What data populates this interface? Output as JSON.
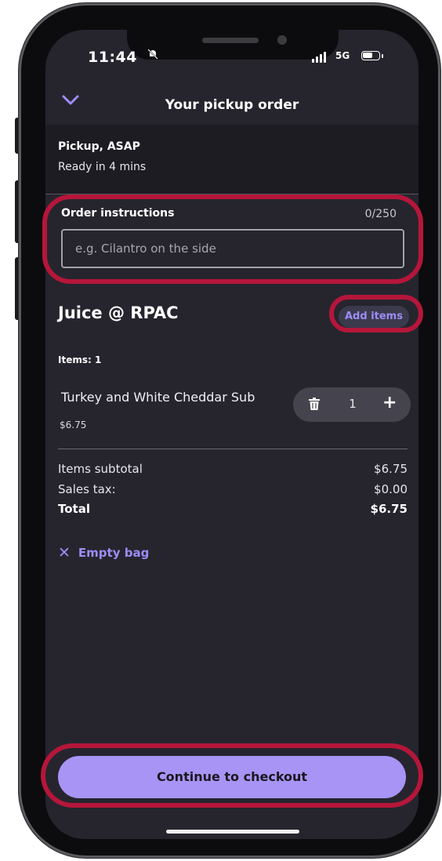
{
  "status_bar": {
    "time": "11:44",
    "network": "5G"
  },
  "header": {
    "title": "Your pickup order"
  },
  "pickup": {
    "title": "Pickup, ASAP",
    "subtitle": "Ready in 4 mins"
  },
  "instructions": {
    "label": "Order instructions",
    "count": "0/250",
    "placeholder": "e.g. Cilantro on the side",
    "value": ""
  },
  "store": {
    "name": "Juice @ RPAC",
    "add_items_label": "Add items"
  },
  "items": {
    "count_label": "Items: 1",
    "list": [
      {
        "name": "Turkey and White Cheddar Sub",
        "price": "$6.75",
        "quantity": "1"
      }
    ]
  },
  "summary": {
    "subtotal_label": "Items subtotal",
    "subtotal_value": "$6.75",
    "tax_label": "Sales tax:",
    "tax_value": "$0.00",
    "total_label": "Total",
    "total_value": "$6.75"
  },
  "empty_bag_label": "Empty bag",
  "checkout_label": "Continue to checkout",
  "colors": {
    "accent": "#9d8cf6",
    "checkout_bg": "#a794f4",
    "annotation": "#b5163a",
    "screen_bg": "#26252e"
  },
  "icons": [
    "chevron-down-icon",
    "bell-muted-icon",
    "signal-icon",
    "battery-icon",
    "trash-icon",
    "plus-icon",
    "close-icon"
  ]
}
